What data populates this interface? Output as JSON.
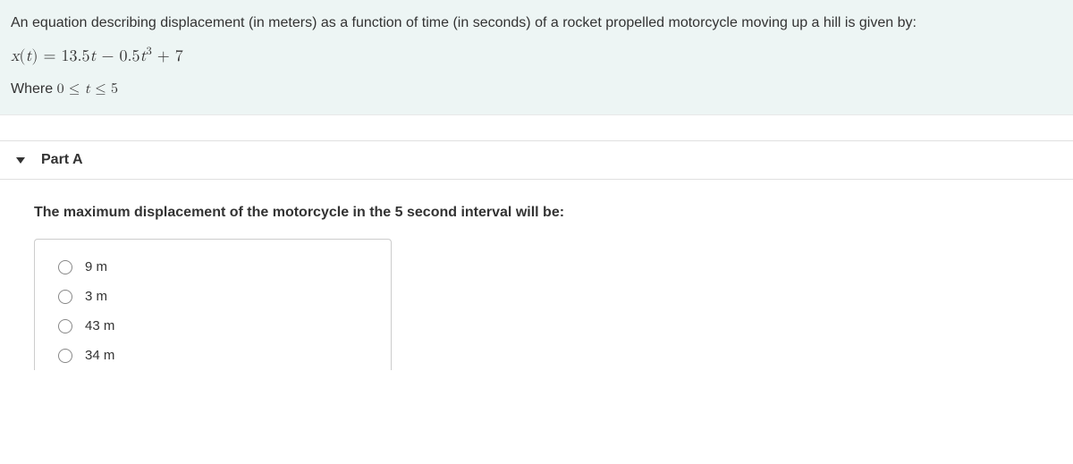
{
  "problem": {
    "intro": "An equation describing displacement (in meters) as a function of time (in seconds) of a rocket propelled motorcycle moving up a hill is given by:",
    "equation_html": "<span class='upright'></span>x<span class='upright'>(</span>t<span class='upright'>) = 13.5</span>t <span class='upright'>− 0.5</span>t<sup>3</sup> <span class='upright'>+ 7</span>",
    "domain_prefix": "Where ",
    "domain_html": "<span class='upright'>0 ≤ </span>t<span class='upright'> ≤ 5</span>"
  },
  "part": {
    "label": "Part A",
    "question": "The maximum displacement of the motorcycle in the 5 second interval will be:",
    "choices": [
      {
        "text": "9 m"
      },
      {
        "text": "3 m"
      },
      {
        "text": "43 m"
      },
      {
        "text": "34 m"
      }
    ]
  }
}
